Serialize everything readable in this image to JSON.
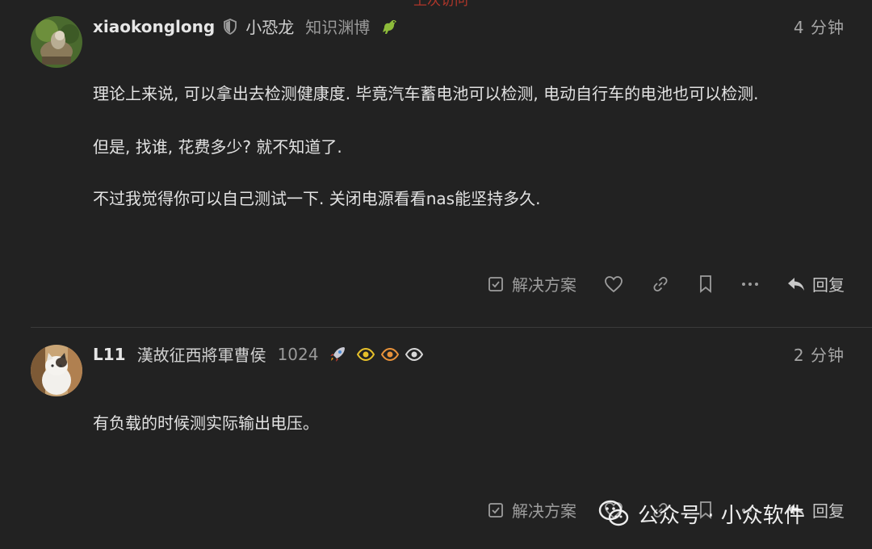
{
  "top_cut_text": "上次访问",
  "posts": [
    {
      "username": "xiaokonglong",
      "full_name": "小恐龙",
      "user_title": "知识渊博",
      "badge_icon": "dinosaur-emoji-icon",
      "time": "4 分钟",
      "paragraphs": [
        "理论上来说, 可以拿出去检测健康度. 毕竟汽车蓄电池可以检测, 电动自行车的电池也可以检测.",
        "但是, 找谁, 花费多少? 就不知道了.",
        "不过我觉得你可以自己测试一下. 关闭电源看看nas能坚持多久."
      ],
      "solution_label": "解决方案",
      "reply_label": "回复"
    },
    {
      "username": "L11",
      "full_name": "漢故征西將軍曹侯",
      "user_title": "1024",
      "badge_icons": [
        "rocket-icon",
        "eye-icon-yellow",
        "eye-icon-orange",
        "eye-icon-white"
      ],
      "time": "2 分钟",
      "paragraphs": [
        "有负载的时候测实际输出电压。"
      ],
      "solution_label": "解决方案",
      "reply_label": "回复"
    }
  ],
  "watermark": {
    "text": "公众号 · 小众软件",
    "icon": "wechat-icon"
  }
}
